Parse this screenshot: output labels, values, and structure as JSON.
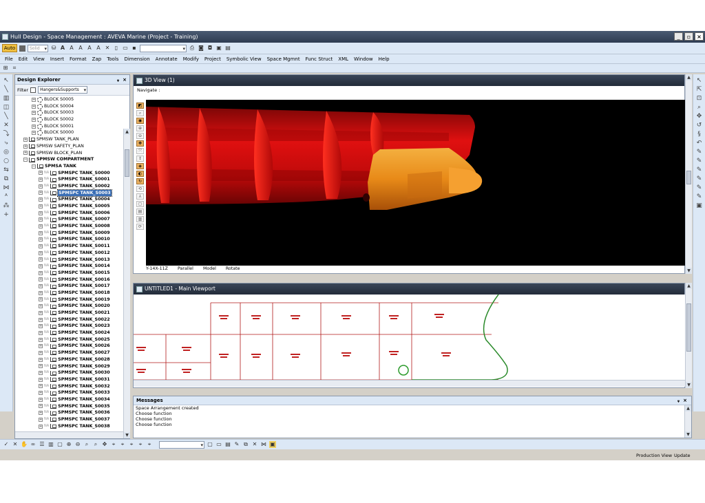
{
  "window": {
    "title": "Hull Design - Space Management : AVEVA Marine (Project - Training)"
  },
  "toolbar": {
    "auto_label": "Auto",
    "solid_label": "Solid"
  },
  "menu": [
    "File",
    "Edit",
    "View",
    "Insert",
    "Format",
    "Zap",
    "Tools",
    "Dimension",
    "Annotate",
    "Modify",
    "Project",
    "Symbolic View",
    "Space Mgmnt",
    "Func Struct",
    "XML",
    "Window",
    "Help"
  ],
  "explorer": {
    "title": "Design Explorer",
    "pin": "ᵩ",
    "close": "×",
    "filter_label": "Filter",
    "filter_value": "Hangers&Supports",
    "blocks": [
      "BLOCK S0005",
      "BLOCK S0004",
      "BLOCK S0003",
      "BLOCK S0002",
      "BLOCK S0001",
      "BLOCK S0000"
    ],
    "plans": [
      "SPMSW TANK_PLAN",
      "SPMSW SAFETY_PLAN",
      "SPMSW BLOCK_PLAN"
    ],
    "compartment": "SPMSW COMPARTMENT",
    "tank_group": "SPMSA TANK",
    "na_tag": "NA",
    "tanks": [
      "SPMSPC TANK_S0000",
      "SPMSPC TANK_S0001",
      "SPMSPC TANK_S0002",
      "SPMSPC TANK_S0003",
      "SPMSPC TANK_S0004",
      "SPMSPC TANK_S0005",
      "SPMSPC TANK_S0006",
      "SPMSPC TANK_S0007",
      "SPMSPC TANK_S0008",
      "SPMSPC TANK_S0009",
      "SPMSPC TANK_S0010",
      "SPMSPC TANK_S0011",
      "SPMSPC TANK_S0012",
      "SPMSPC TANK_S0013",
      "SPMSPC TANK_S0014",
      "SPMSPC TANK_S0015",
      "SPMSPC TANK_S0016",
      "SPMSPC TANK_S0017",
      "SPMSPC TANK_S0018",
      "SPMSPC TANK_S0019",
      "SPMSPC TANK_S0020",
      "SPMSPC TANK_S0021",
      "SPMSPC TANK_S0022",
      "SPMSPC TANK_S0023",
      "SPMSPC TANK_S0024",
      "SPMSPC TANK_S0025",
      "SPMSPC TANK_S0026",
      "SPMSPC TANK_S0027",
      "SPMSPC TANK_S0028",
      "SPMSPC TANK_S0029",
      "SPMSPC TANK_S0030",
      "SPMSPC TANK_S0031",
      "SPMSPC TANK_S0032",
      "SPMSPC TANK_S0033",
      "SPMSPC TANK_S0034",
      "SPMSPC TANK_S0035",
      "SPMSPC TANK_S0036",
      "SPMSPC TANK_S0037",
      "SPMSPC TANK_S0038"
    ],
    "selected_tank": "SPMSPC TANK_S0003"
  },
  "view3d": {
    "title": "3D View (1)",
    "navigate_label": "Navigate :",
    "direction": "Y-14X-11Z",
    "projection": "Parallel",
    "mode": "Model",
    "action": "Rotate"
  },
  "viewport": {
    "title": "UNTITLED1 - Main Viewport"
  },
  "messages": {
    "title": "Messages",
    "lines": [
      "Space Arrangement created",
      "Choose function",
      "Choose function",
      "Choose function"
    ]
  },
  "status": {
    "production_view": "Production View",
    "update": "Update"
  },
  "colors": {
    "accent": "#f0c040",
    "selection": "#3b6fb6",
    "hull_red": "#e81010",
    "hull_orange": "#f09020",
    "compartment_line": "#b01818",
    "hull_outline": "#2a8a2a"
  }
}
